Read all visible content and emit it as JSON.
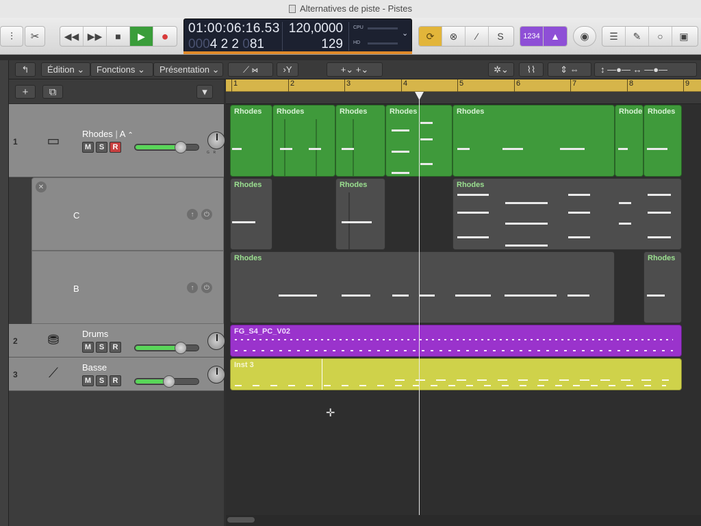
{
  "window": {
    "title": "Alternatives de piste - Pistes"
  },
  "lcd": {
    "time": "01:00:06:16.53",
    "bar": "4",
    "beat": "2",
    "division": "2",
    "tick": "81",
    "tempo": "120,0000",
    "tempo_lower": "129",
    "cpu_label": "CPU",
    "hd_label": "HD"
  },
  "control_bar": {
    "counter_label": "1234"
  },
  "toolbar": {
    "edit_menu": "Édition",
    "functions_menu": "Fonctions",
    "view_menu": "Présentation"
  },
  "ruler": {
    "bars": [
      "1",
      "2",
      "3",
      "4",
      "5",
      "6",
      "7",
      "8",
      "9"
    ]
  },
  "tracks": [
    {
      "number": "1",
      "name": "Rhodes",
      "alternative": "A",
      "mute": "M",
      "solo": "S",
      "record": "R"
    },
    {
      "number": "2",
      "name": "Drums",
      "mute": "M",
      "solo": "S",
      "record": "R"
    },
    {
      "number": "3",
      "name": "Basse",
      "mute": "M",
      "solo": "S",
      "record": "R"
    }
  ],
  "alt_lanes": [
    {
      "name": "C"
    },
    {
      "name": "B"
    }
  ],
  "regions": {
    "rhodes_a": [
      "Rhodes",
      "Rhodes",
      "Rhodes",
      "Rhodes",
      "Rhodes",
      "Rhodes",
      "Rhodes"
    ],
    "rhodes_c": [
      "Rhodes",
      "Rhodes",
      "Rhodes"
    ],
    "rhodes_b": [
      "Rhodes",
      "Rhodes"
    ],
    "drums": "FG_S4_PC_V02",
    "bass": "Inst 3"
  },
  "pan_labels": {
    "left": "G",
    "right": "R"
  },
  "colors": {
    "green_region": "#3f9a3b",
    "gray_region": "#4d4d4d",
    "purple_region": "#9a33cc",
    "yellow_region": "#cfd24a",
    "play_green": "#3a9d3a",
    "record_red": "#d83a3a",
    "cycle_yellow": "#e2b53a",
    "counter_purple": "#8e4fd6"
  },
  "icons": [
    "mixer-icon",
    "scissors-icon",
    "rewind-icon",
    "fast-forward-icon",
    "stop-icon",
    "play-icon",
    "record-icon",
    "cycle-icon",
    "replace-icon",
    "tuner-icon",
    "solo-icon",
    "metronome-icon",
    "list-icon",
    "note-pad-icon",
    "loops-icon",
    "browser-icon",
    "gear-icon",
    "waveform-icon",
    "plus-icon",
    "duplicate-icon",
    "collapse-icon"
  ]
}
